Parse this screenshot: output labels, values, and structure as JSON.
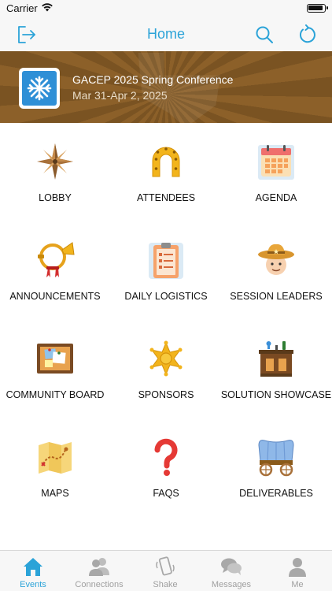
{
  "status_bar": {
    "carrier": "Carrier"
  },
  "nav": {
    "title": "Home"
  },
  "event": {
    "name": "GACEP 2025 Spring Conference",
    "dates": "Mar 31-Apr 2, 2025"
  },
  "menu": [
    {
      "label": "LOBBY",
      "icon": "compass-rose-icon"
    },
    {
      "label": "ATTENDEES",
      "icon": "horseshoe-icon"
    },
    {
      "label": "AGENDA",
      "icon": "calendar-icon"
    },
    {
      "label": "ANNOUNCEMENTS",
      "icon": "bugle-horn-icon"
    },
    {
      "label": "DAILY LOGISTICS",
      "icon": "clipboard-icon"
    },
    {
      "label": "SESSION LEADERS",
      "icon": "cowboy-icon"
    },
    {
      "label": "COMMUNITY BOARD",
      "icon": "cork-board-icon"
    },
    {
      "label": "SPONSORS",
      "icon": "sheriff-star-icon"
    },
    {
      "label": "SOLUTION SHOWCASE",
      "icon": "saloon-bar-icon"
    },
    {
      "label": "MAPS",
      "icon": "treasure-map-icon"
    },
    {
      "label": "FAQS",
      "icon": "question-mark-icon"
    },
    {
      "label": "DELIVERABLES",
      "icon": "covered-wagon-icon"
    }
  ],
  "tabs": [
    {
      "label": "Events",
      "icon": "home-icon",
      "active": true
    },
    {
      "label": "Connections",
      "icon": "people-icon",
      "active": false
    },
    {
      "label": "Shake",
      "icon": "shake-phone-icon",
      "active": false
    },
    {
      "label": "Messages",
      "icon": "chat-bubbles-icon",
      "active": false
    },
    {
      "label": "Me",
      "icon": "person-icon",
      "active": false
    }
  ],
  "colors": {
    "accent": "#2ba3d8",
    "banner": "#7a5322",
    "inactive_tab": "#a0a0a0"
  }
}
